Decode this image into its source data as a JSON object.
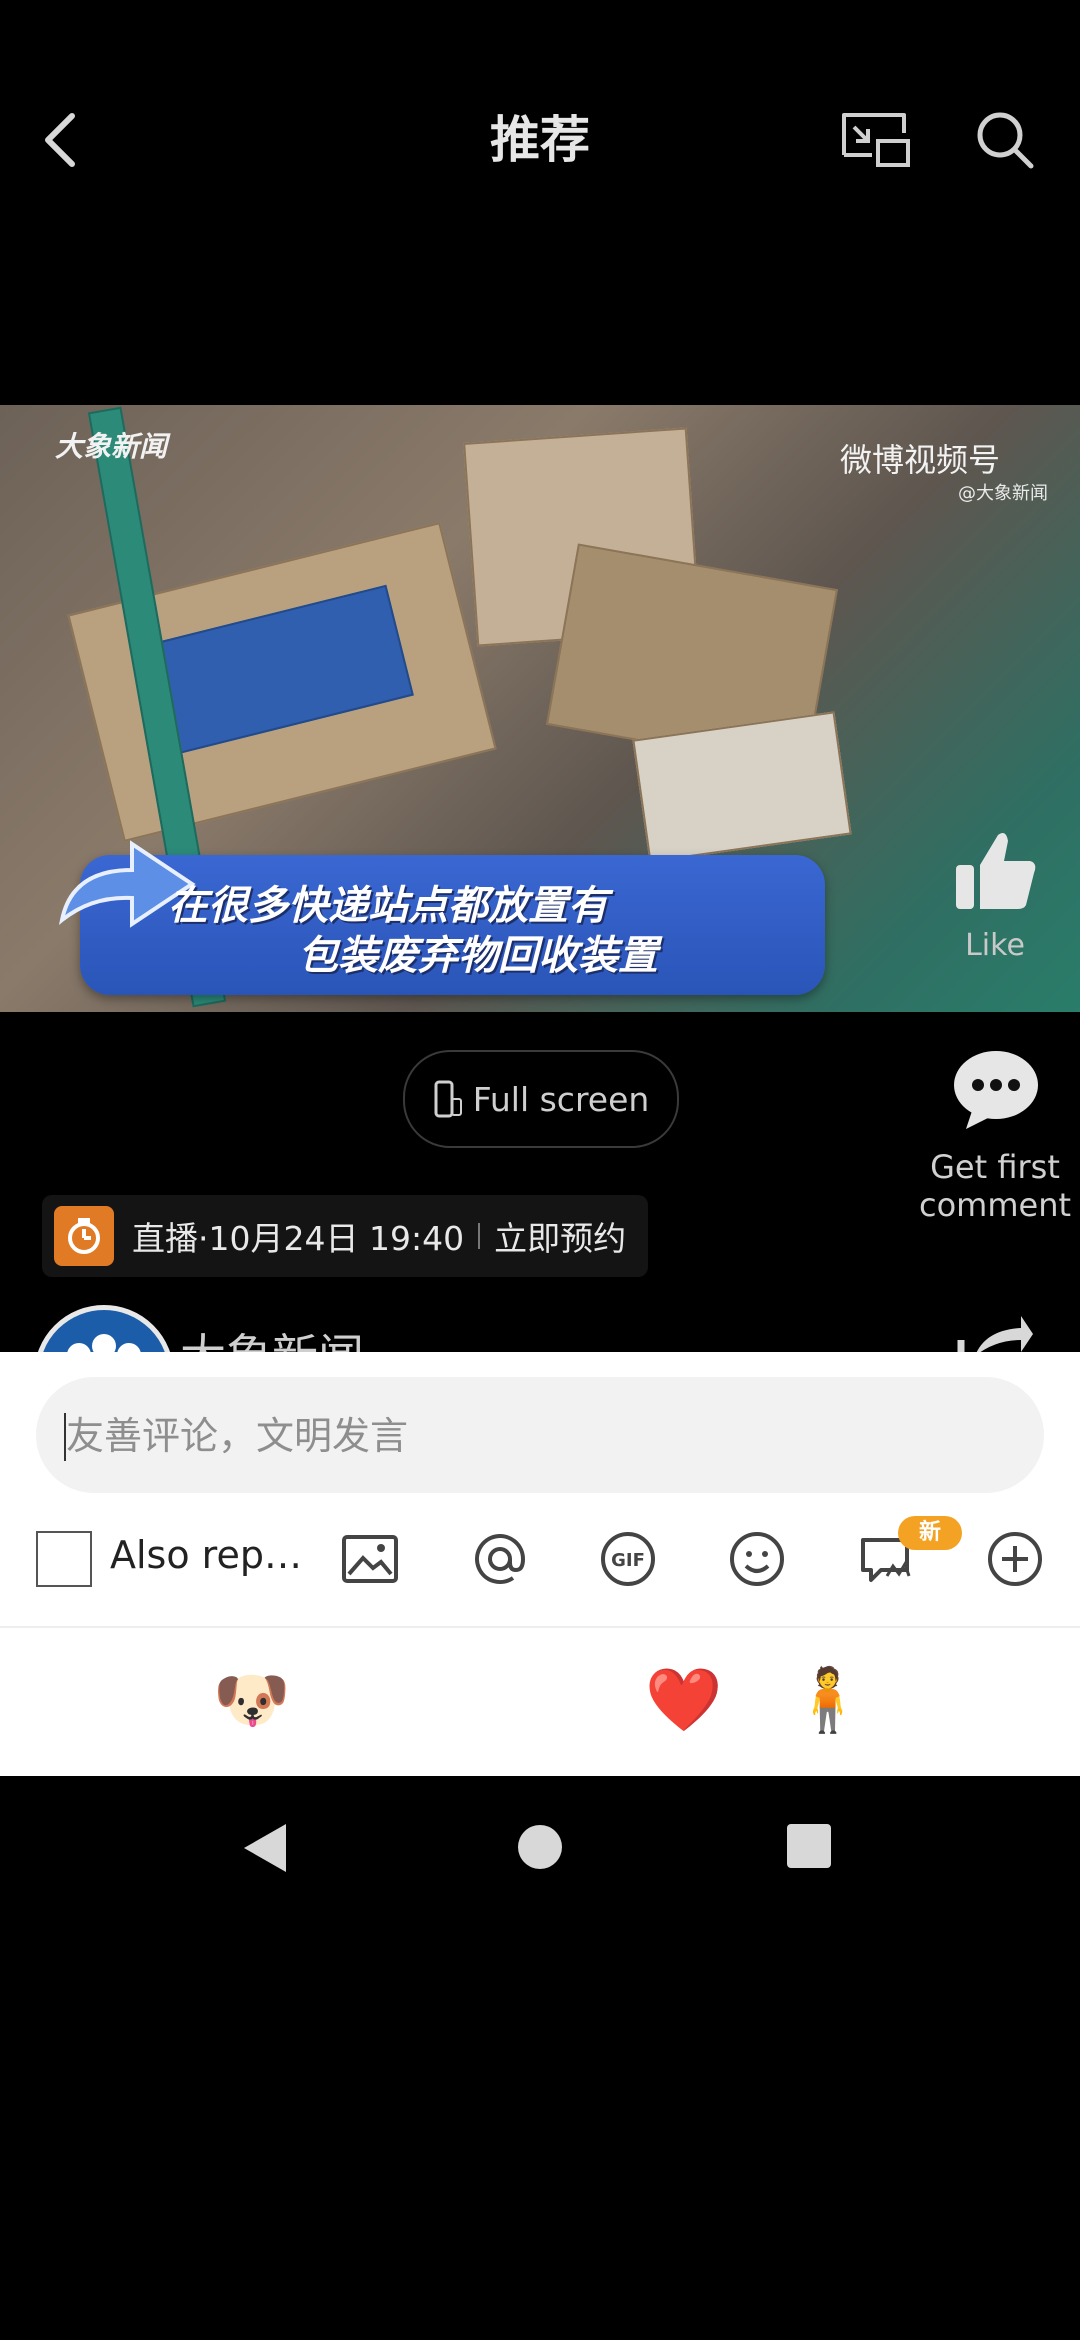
{
  "header": {
    "title": "推荐",
    "back_icon": "chevron-left-icon",
    "pip_icon": "picture-in-picture-icon",
    "search_icon": "search-icon"
  },
  "video": {
    "watermark_left": "大象新闻",
    "watermark_right": "微博视频号",
    "watermark_right_sub": "@大象新闻",
    "caption_line1": "在很多快递站点都放置有",
    "caption_line2": "包装废弃物回收装置",
    "like_label": "Like"
  },
  "controls": {
    "fullscreen_label": "Full screen",
    "comment_label": "Get first comment"
  },
  "live": {
    "text": "直播·10月24日 19:40",
    "cta": "立即预约"
  },
  "author": {
    "name": "大象新闻"
  },
  "comment_sheet": {
    "input_placeholder": "友善评论，文明发言",
    "repost_label": "Also rep…",
    "new_badge": "新",
    "tools": [
      "image-icon",
      "at-icon",
      "gif-icon",
      "emoji-icon",
      "super-comment-icon",
      "plus-icon"
    ],
    "emojis": [
      "😭",
      "🐶",
      "😂",
      "😆",
      "❤️",
      "🧍",
      "😂"
    ]
  },
  "colors": {
    "accent": "#f4a223",
    "caption_bg": "#3a67d2",
    "live_icon_bg": "#e07a25"
  }
}
